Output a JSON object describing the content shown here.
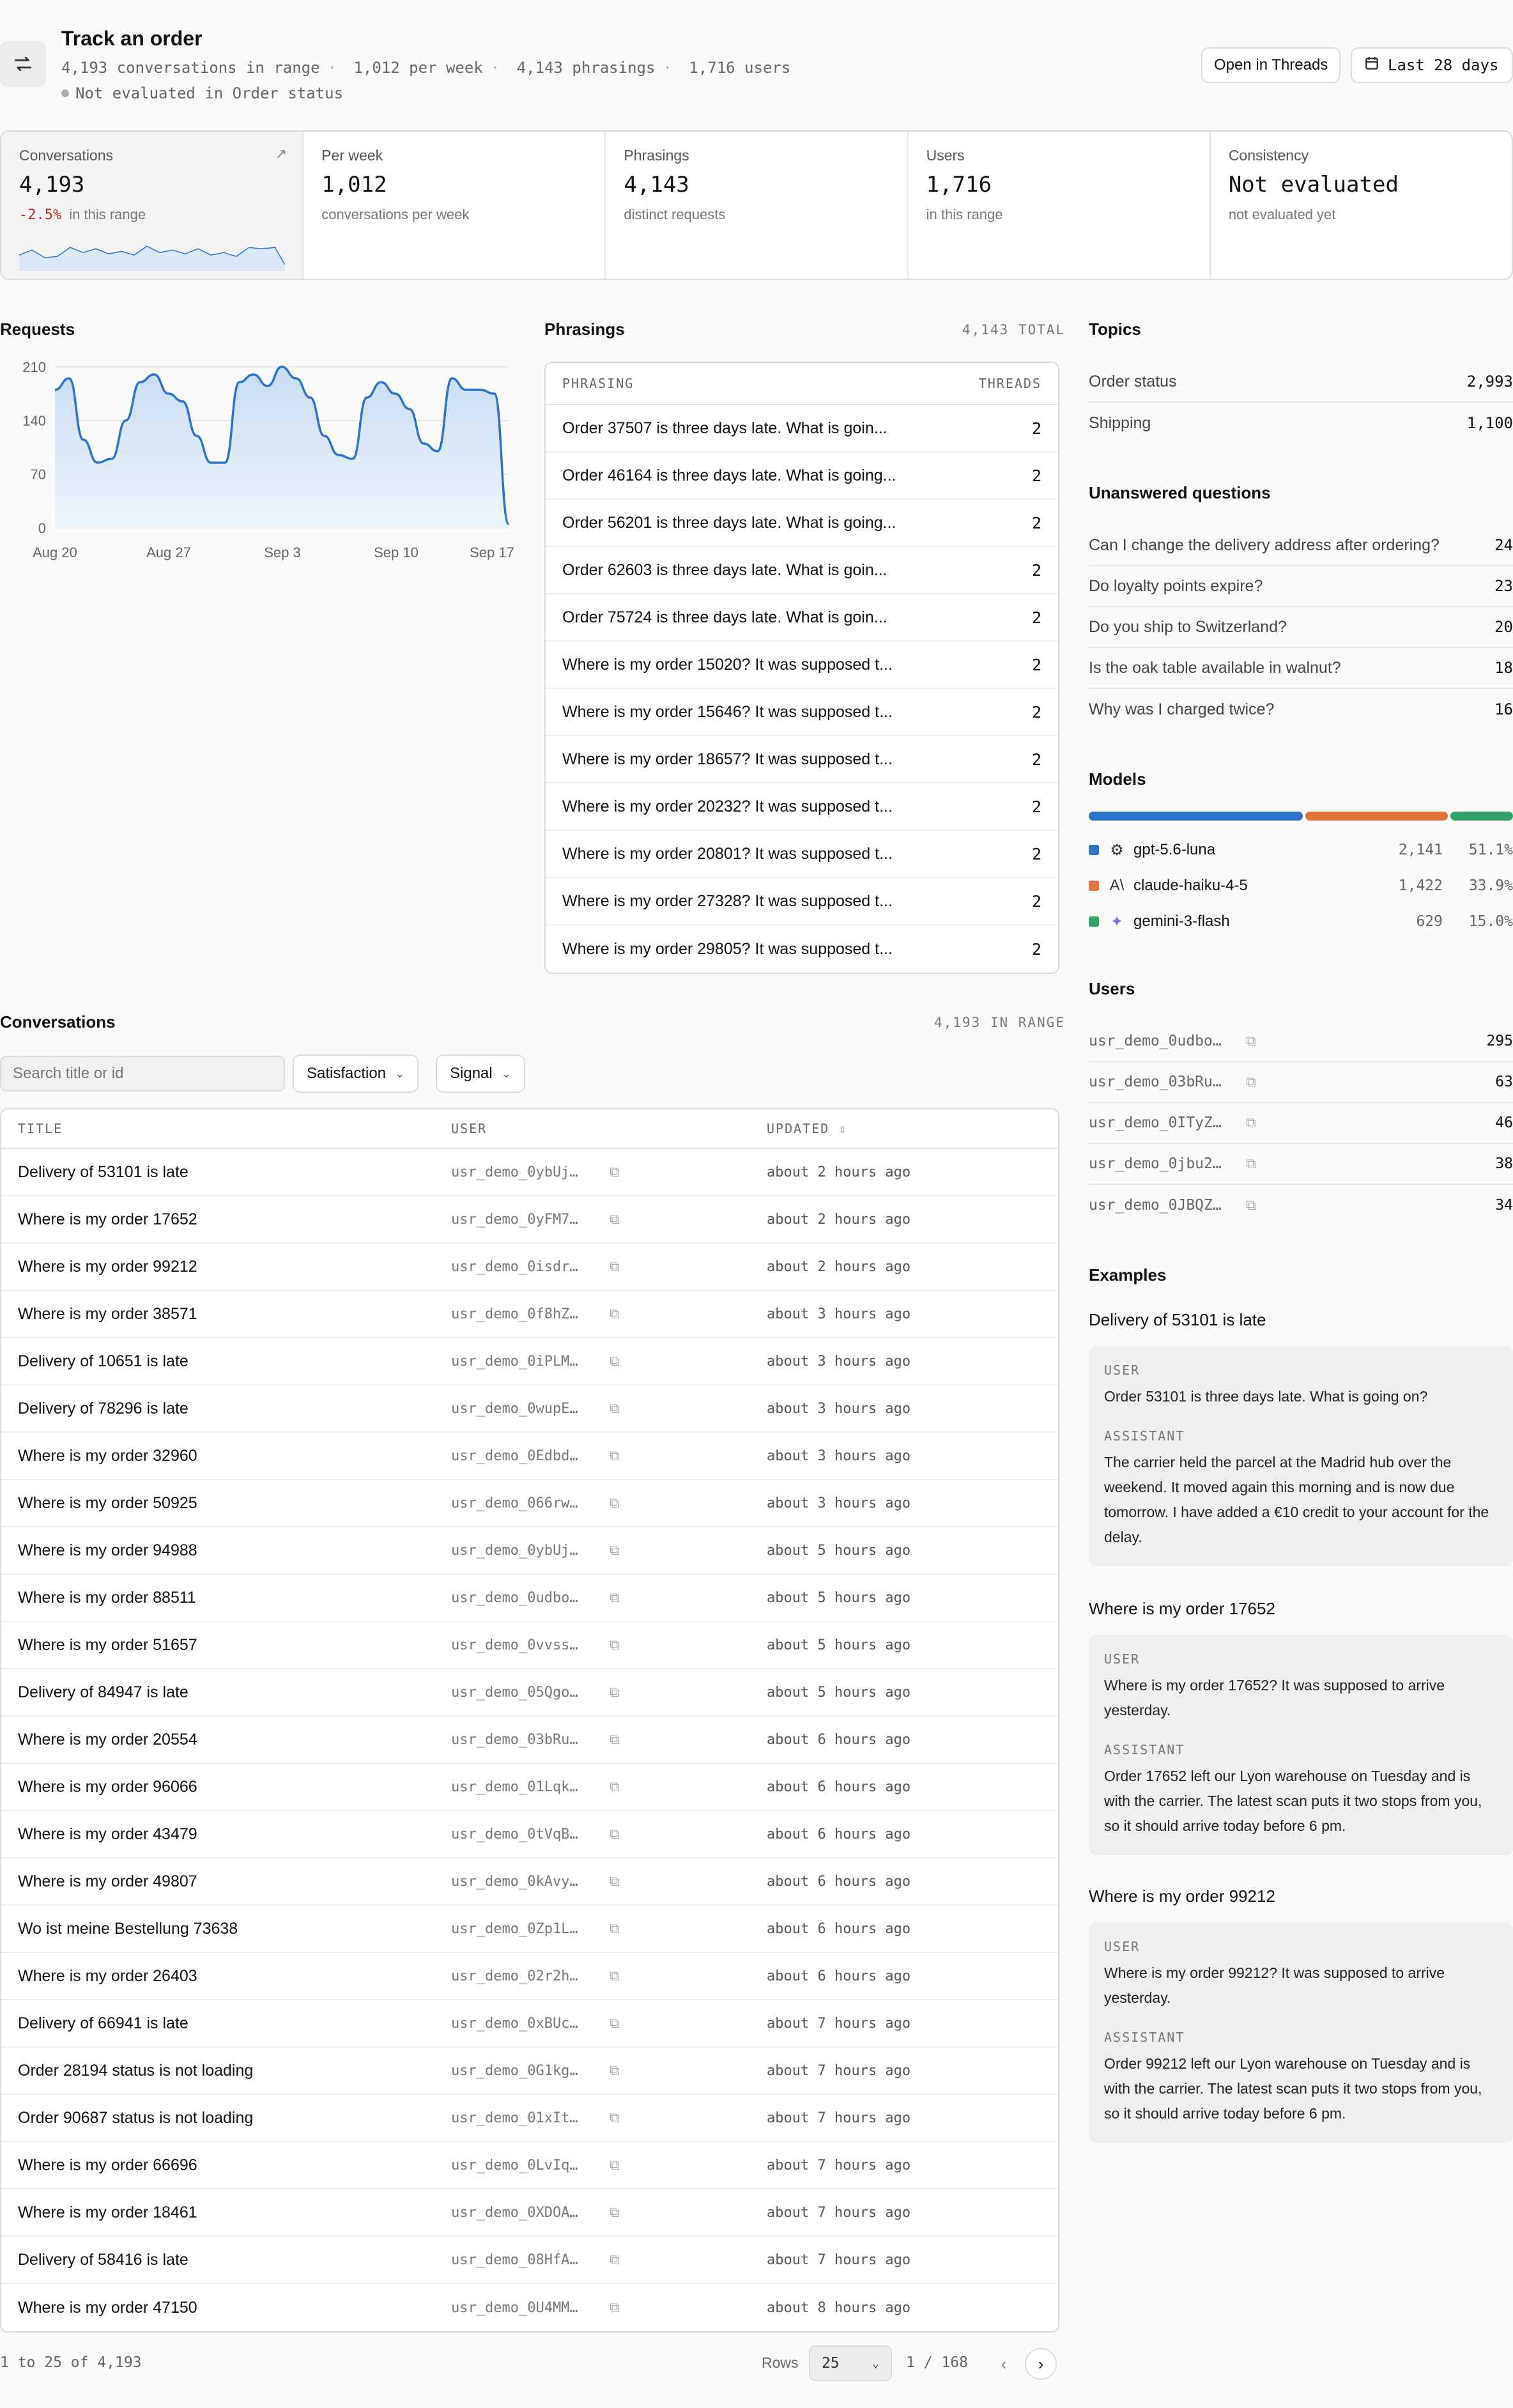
{
  "header": {
    "title": "Track an order",
    "meta": [
      "4,193 conversations in range",
      "1,012 per week",
      "4,143 phrasings",
      "1,716 users"
    ],
    "meta_sep": "·",
    "status": "Not evaluated in Order status",
    "open_threads_label": "Open in Threads",
    "range_label": "Last 28 days"
  },
  "kpis": [
    {
      "label": "Conversations",
      "value": "4,193",
      "delta": "-2.5%",
      "sub": "in this range"
    },
    {
      "label": "Per week",
      "value": "1,012",
      "sub": "conversations per week"
    },
    {
      "label": "Phrasings",
      "value": "4,143",
      "sub": "distinct requests"
    },
    {
      "label": "Users",
      "value": "1,716",
      "sub": "in this range"
    },
    {
      "label": "Consistency",
      "value": "Not evaluated",
      "sub": "not evaluated yet"
    }
  ],
  "requests": {
    "title": "Requests",
    "chart_data": {
      "type": "area",
      "title": "Requests",
      "x_ticks": [
        "Aug 20",
        "Aug 27",
        "Sep 3",
        "Sep 10",
        "Sep 17"
      ],
      "y_ticks": [
        "0",
        "70",
        "140",
        "210"
      ],
      "ylim": [
        0,
        210
      ],
      "values": [
        180,
        195,
        115,
        85,
        90,
        140,
        190,
        200,
        175,
        165,
        120,
        85,
        85,
        190,
        200,
        185,
        210,
        195,
        170,
        120,
        95,
        90,
        170,
        190,
        175,
        155,
        110,
        100,
        195,
        180,
        180,
        175,
        5
      ],
      "color": "#2f73c9"
    }
  },
  "phrasings": {
    "title": "Phrasings",
    "total": "4,143 TOTAL",
    "col_phrasing": "PHRASING",
    "col_threads": "THREADS",
    "rows": [
      {
        "text": "Order 37507 is three days late. What is goin...",
        "n": "2"
      },
      {
        "text": "Order 46164 is three days late. What is going...",
        "n": "2"
      },
      {
        "text": "Order 56201 is three days late. What is going...",
        "n": "2"
      },
      {
        "text": "Order 62603 is three days late. What is goin...",
        "n": "2"
      },
      {
        "text": "Order 75724 is three days late. What is goin...",
        "n": "2"
      },
      {
        "text": "Where is my order 15020? It was supposed t...",
        "n": "2"
      },
      {
        "text": "Where is my order 15646? It was supposed t...",
        "n": "2"
      },
      {
        "text": "Where is my order 18657? It was supposed t...",
        "n": "2"
      },
      {
        "text": "Where is my order 20232? It was supposed t...",
        "n": "2"
      },
      {
        "text": "Where is my order 20801? It was supposed t...",
        "n": "2"
      },
      {
        "text": "Where is my order 27328? It was supposed t...",
        "n": "2"
      },
      {
        "text": "Where is my order 29805? It was supposed t...",
        "n": "2"
      }
    ]
  },
  "topics": {
    "title": "Topics",
    "rows": [
      {
        "name": "Order status",
        "n": "2,993"
      },
      {
        "name": "Shipping",
        "n": "1,100"
      }
    ]
  },
  "unanswered": {
    "title": "Unanswered questions",
    "rows": [
      {
        "q": "Can I change the delivery address after ordering?",
        "n": "24"
      },
      {
        "q": "Do loyalty points expire?",
        "n": "23"
      },
      {
        "q": "Do you ship to Switzerland?",
        "n": "20"
      },
      {
        "q": "Is the oak table available in walnut?",
        "n": "18"
      },
      {
        "q": "Why was I charged twice?",
        "n": "16"
      }
    ]
  },
  "models": {
    "title": "Models",
    "rows": [
      {
        "name": "gpt-5.6-luna",
        "count": "2,141",
        "pct": "51.1%",
        "share": 0.511,
        "color": "#2f73c9",
        "icon": "openai-icon"
      },
      {
        "name": "claude-haiku-4-5",
        "count": "1,422",
        "pct": "33.9%",
        "share": 0.339,
        "color": "#e2723a",
        "icon": "anthropic-icon"
      },
      {
        "name": "gemini-3-flash",
        "count": "629",
        "pct": "15.0%",
        "share": 0.15,
        "color": "#2fa36b",
        "icon": "gemini-icon"
      }
    ]
  },
  "users": {
    "title": "Users",
    "rows": [
      {
        "id": "usr_demo_0udbo…",
        "n": "295"
      },
      {
        "id": "usr_demo_03bRu…",
        "n": "63"
      },
      {
        "id": "usr_demo_0ITyZ…",
        "n": "46"
      },
      {
        "id": "usr_demo_0jbu2…",
        "n": "38"
      },
      {
        "id": "usr_demo_0JBQZ…",
        "n": "34"
      }
    ]
  },
  "examples": {
    "title": "Examples",
    "user_role": "USER",
    "assistant_role": "ASSISTANT",
    "items": [
      {
        "title": "Delivery of 53101 is late",
        "user": "Order 53101 is three days late. What is going on?",
        "assistant": "The carrier held the parcel at the Madrid hub over the weekend. It moved again this morning and is now due tomorrow. I have added a €10 credit to your account for the delay."
      },
      {
        "title": "Where is my order 17652",
        "user": "Where is my order 17652? It was supposed to arrive yesterday.",
        "assistant": "Order 17652 left our Lyon warehouse on Tuesday and is with the carrier. The latest scan puts it two stops from you, so it should arrive today before 6 pm."
      },
      {
        "title": "Where is my order 99212",
        "user": "Where is my order 99212? It was supposed to arrive yesterday.",
        "assistant": "Order 99212 left our Lyon warehouse on Tuesday and is with the carrier. The latest scan puts it two stops from you, so it should arrive today before 6 pm."
      }
    ]
  },
  "conversations": {
    "title": "Conversations",
    "count": "4,193 IN RANGE",
    "search_placeholder": "Search title or id",
    "filter_satisfaction": "Satisfaction",
    "filter_signal": "Signal",
    "col_title": "TITLE",
    "col_user": "USER",
    "col_updated": "UPDATED",
    "rows": [
      {
        "t": "Delivery of 53101 is late",
        "u": "usr_demo_0ybUj…",
        "d": "about 2 hours ago"
      },
      {
        "t": "Where is my order 17652",
        "u": "usr_demo_0yFM7…",
        "d": "about 2 hours ago"
      },
      {
        "t": "Where is my order 99212",
        "u": "usr_demo_0isdr…",
        "d": "about 2 hours ago"
      },
      {
        "t": "Where is my order 38571",
        "u": "usr_demo_0f8hZ…",
        "d": "about 3 hours ago"
      },
      {
        "t": "Delivery of 10651 is late",
        "u": "usr_demo_0iPLM…",
        "d": "about 3 hours ago"
      },
      {
        "t": "Delivery of 78296 is late",
        "u": "usr_demo_0wupE…",
        "d": "about 3 hours ago"
      },
      {
        "t": "Where is my order 32960",
        "u": "usr_demo_0Edbd…",
        "d": "about 3 hours ago"
      },
      {
        "t": "Where is my order 50925",
        "u": "usr_demo_066rw…",
        "d": "about 3 hours ago"
      },
      {
        "t": "Where is my order 94988",
        "u": "usr_demo_0ybUj…",
        "d": "about 5 hours ago"
      },
      {
        "t": "Where is my order 88511",
        "u": "usr_demo_0udbo…",
        "d": "about 5 hours ago"
      },
      {
        "t": "Where is my order 51657",
        "u": "usr_demo_0vvss…",
        "d": "about 5 hours ago"
      },
      {
        "t": "Delivery of 84947 is late",
        "u": "usr_demo_05Qgo…",
        "d": "about 5 hours ago"
      },
      {
        "t": "Where is my order 20554",
        "u": "usr_demo_03bRu…",
        "d": "about 6 hours ago"
      },
      {
        "t": "Where is my order 96066",
        "u": "usr_demo_01Lqk…",
        "d": "about 6 hours ago"
      },
      {
        "t": "Where is my order 43479",
        "u": "usr_demo_0tVqB…",
        "d": "about 6 hours ago"
      },
      {
        "t": "Where is my order 49807",
        "u": "usr_demo_0kAvy…",
        "d": "about 6 hours ago"
      },
      {
        "t": "Wo ist meine Bestellung 73638",
        "u": "usr_demo_0Zp1L…",
        "d": "about 6 hours ago"
      },
      {
        "t": "Where is my order 26403",
        "u": "usr_demo_02r2h…",
        "d": "about 6 hours ago"
      },
      {
        "t": "Delivery of 66941 is late",
        "u": "usr_demo_0xBUc…",
        "d": "about 7 hours ago"
      },
      {
        "t": "Order 28194 status is not loading",
        "u": "usr_demo_0G1kg…",
        "d": "about 7 hours ago"
      },
      {
        "t": "Order 90687 status is not loading",
        "u": "usr_demo_01xIt…",
        "d": "about 7 hours ago"
      },
      {
        "t": "Where is my order 66696",
        "u": "usr_demo_0LvIq…",
        "d": "about 7 hours ago"
      },
      {
        "t": "Where is my order 18461",
        "u": "usr_demo_0XDOA…",
        "d": "about 7 hours ago"
      },
      {
        "t": "Delivery of 58416 is late",
        "u": "usr_demo_08HfA…",
        "d": "about 7 hours ago"
      },
      {
        "t": "Where is my order 47150",
        "u": "usr_demo_0U4MM…",
        "d": "about 8 hours ago"
      }
    ]
  },
  "pagination": {
    "summary": "1 to 25 of 4,193",
    "rows_label": "Rows",
    "rows_value": "25",
    "page": "1 / 168"
  }
}
